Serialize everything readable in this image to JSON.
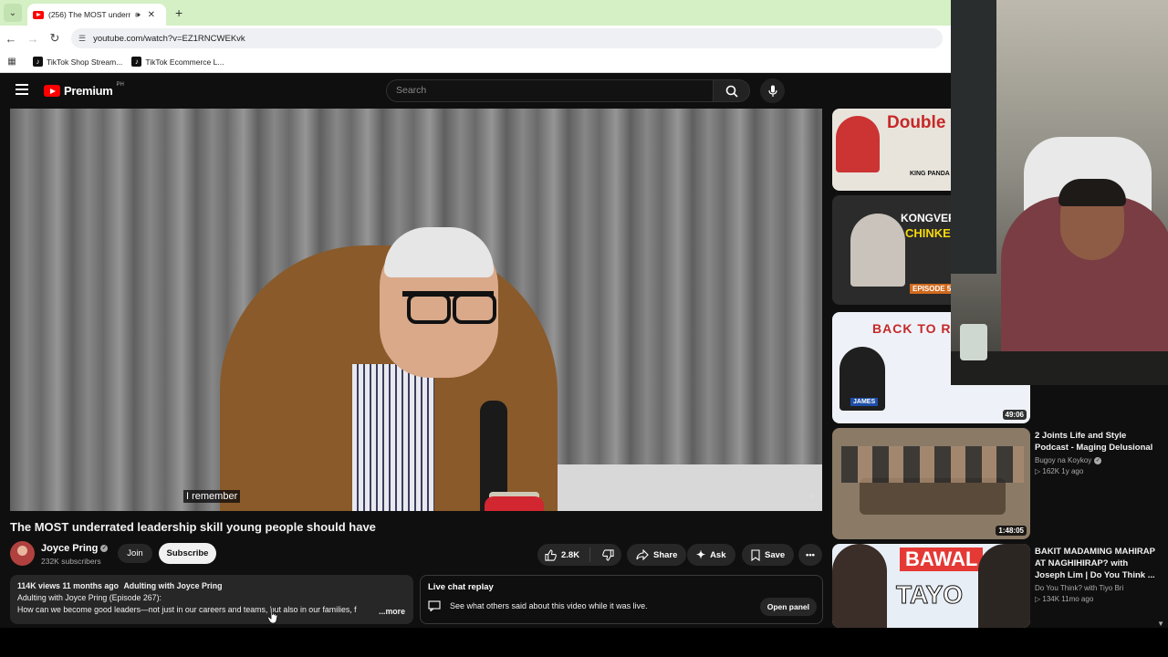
{
  "browser": {
    "tab_title": "(256) The MOST underrated",
    "url": "youtube.com/watch?v=EZ1RNCWEKvk",
    "bookmarks": [
      "TikTok Shop Stream...",
      "TikTok Ecommerce L..."
    ]
  },
  "youtube": {
    "logo_text": "Premium",
    "logo_region": "PH",
    "search_placeholder": "Search"
  },
  "video": {
    "caption": "I remember",
    "title": "The MOST underrated leadership skill young people should have",
    "channel": "Joyce Pring",
    "subscribers": "232K subscribers",
    "join_label": "Join",
    "subscribe_label": "Subscribe",
    "likes": "2.8K",
    "share_label": "Share",
    "ask_label": "Ask",
    "save_label": "Save",
    "description": {
      "meta": "114K views  11 months ago",
      "tag": "Adulting with Joyce Pring",
      "line1": "Adulting with Joyce Pring (Episode 267):",
      "line2": "How can we become good leaders—not just in our careers and teams, but also in our families, f",
      "more": "...more"
    }
  },
  "live_chat": {
    "title": "Live chat replay",
    "text": "See what others said about this video while it was live.",
    "button": "Open panel"
  },
  "recommendations": [
    {
      "thumb_text": "Double My Inco",
      "thumb_sub": "KING PANDA",
      "title": "",
      "channel": "",
      "meta": "",
      "duration": "",
      "color": "#e8e4dc"
    },
    {
      "thumb_text": "KONGVERSA",
      "thumb_sub": "CHINKEE",
      "badge": "EPISODE 5",
      "title": "",
      "channel": "",
      "meta": "",
      "duration": "",
      "color": "#2b2b2b"
    },
    {
      "thumb_text": "BACK TO R",
      "thumb_sub": "JAMES",
      "title": "",
      "channel": "",
      "meta": "",
      "duration": "49:06",
      "color": "#eef2f8"
    },
    {
      "thumb_text": "",
      "title": "2 Joints Life and Style Podcast - Maging Delusional",
      "title2": "Podcast - Maging Delusional",
      "title1": "2 Joints Life and Style",
      "channel": "Bugoy na Koykoy",
      "meta": "▷ 162K   1y ago",
      "duration": "1:48:05",
      "color": "#8a7a66"
    },
    {
      "thumb_text": "BAWAL",
      "thumb_sub": "TAYO",
      "title1": "BAKIT MADAMING MAHIRAP",
      "title2": "AT NAGHIHIRAP? with",
      "title3": "Joseph Lim | Do You Think ...",
      "channel": "Do You Think? with Tiyo Bri",
      "meta": "▷ 134K   11mo ago",
      "duration": "",
      "color": "#1e5aa8"
    }
  ]
}
